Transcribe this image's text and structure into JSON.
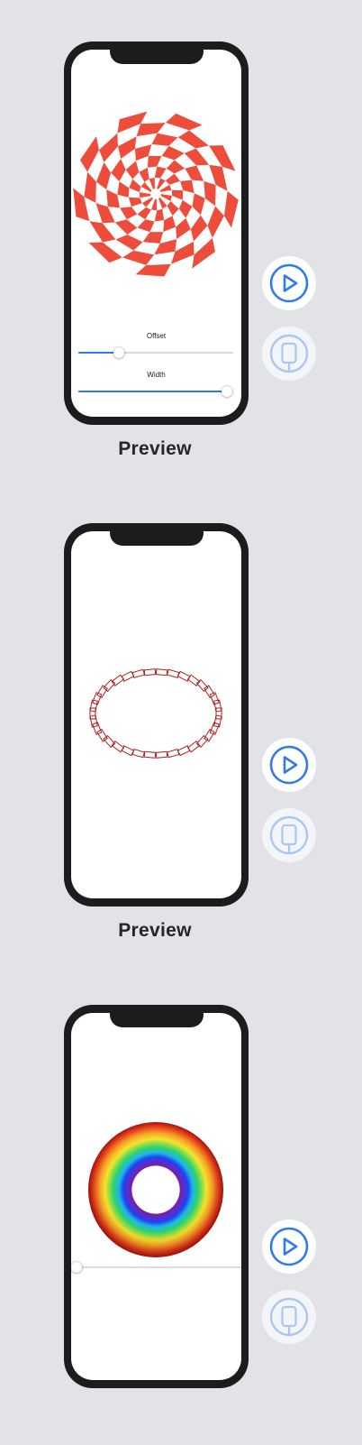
{
  "previews": [
    {
      "label": "Preview",
      "controls": [
        {
          "label": "Offset",
          "value": 0.26
        },
        {
          "label": "Width",
          "value": 0.96
        }
      ]
    },
    {
      "label": "Preview"
    },
    {
      "label": "",
      "slider": {
        "value": 0.0
      }
    }
  ],
  "buttons": {
    "play_icon": "play-circle-icon",
    "device_icon": "device-phone-icon"
  },
  "colors": {
    "accent": "#2f7bea",
    "pinwheel_red": "#ef4d3c",
    "background": "#e2e3e7",
    "device_bezel": "#1c1c1e"
  }
}
